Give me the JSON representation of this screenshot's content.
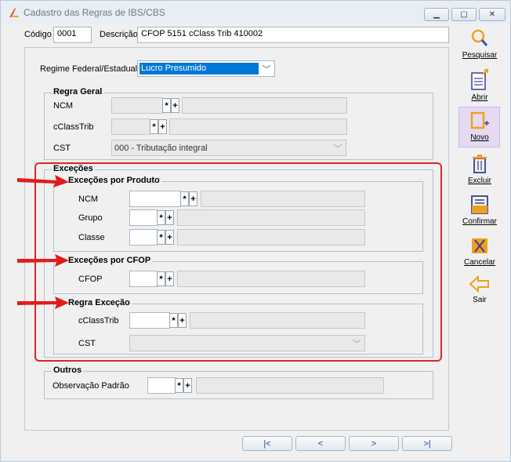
{
  "window": {
    "title": "Cadastro das Regras de IBS/CBS"
  },
  "header": {
    "codigo_label": "Código",
    "codigo_value": "0001",
    "descricao_label": "Descrição",
    "descricao_value": "CFOP 5151 cClass Trib 410002"
  },
  "regime": {
    "label": "Regime Federal/Estadual",
    "value": "Lucro Presumido"
  },
  "regra_geral": {
    "title": "Regra Geral",
    "ncm_label": "NCM",
    "cclasstrib_label": "cClassTrib",
    "cst_label": "CST",
    "cst_value": "000 - Tributação integral"
  },
  "excecoes": {
    "title": "Exceções",
    "produto": {
      "title": "Exceções por Produto",
      "ncm_label": "NCM",
      "grupo_label": "Grupo",
      "classe_label": "Classe"
    },
    "cfop": {
      "title": "Exceções por CFOP",
      "cfop_label": "CFOP"
    },
    "regra": {
      "title": "Regra Exceção",
      "cclasstrib_label": "cClassTrib",
      "cst_label": "CST"
    }
  },
  "outros": {
    "title": "Outros",
    "obs_label": "Observação Padrão"
  },
  "buttons": {
    "star": "*",
    "plus": "+"
  },
  "toolbar": [
    {
      "label": "Pesquisar",
      "icon": "search-icon"
    },
    {
      "label": "Abrir",
      "icon": "open-icon"
    },
    {
      "label": "Novo",
      "icon": "new-icon"
    },
    {
      "label": "Excluir",
      "icon": "delete-icon"
    },
    {
      "label": "Confirmar",
      "icon": "confirm-icon"
    },
    {
      "label": "Cancelar",
      "icon": "cancel-icon"
    },
    {
      "label": "Sair",
      "icon": "exit-icon"
    }
  ],
  "colors": {
    "accent": "#f0a020",
    "selected_bg": "#0078d7",
    "highlight": "#e02424",
    "novo_bg": "#e4dbf3"
  }
}
